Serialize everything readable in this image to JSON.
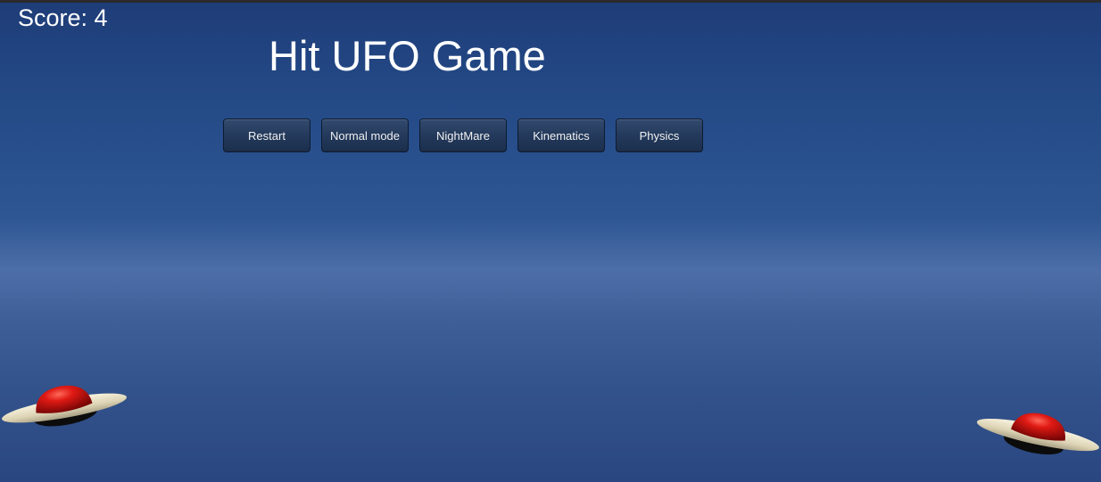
{
  "hud": {
    "score": "Score: 4"
  },
  "title": "Hit UFO Game",
  "buttons": {
    "restart": "Restart",
    "normal_mode": "Normal mode",
    "nightmare": "NightMare",
    "kinematics": "Kinematics",
    "physics": "Physics"
  },
  "colors": {
    "sky_top": "#1e3c78",
    "sky_horizon": "#4d6ea8",
    "button_bg": "#243a5c",
    "ufo_dome": "#d81818",
    "ufo_saucer": "#e9e2c8"
  },
  "sprites": [
    "ufo",
    "ufo"
  ]
}
